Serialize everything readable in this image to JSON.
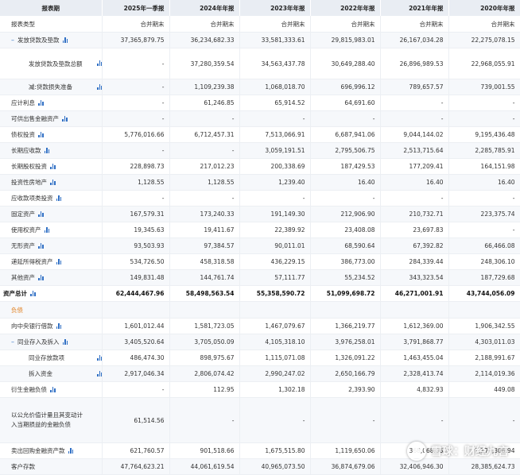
{
  "header": {
    "label": "报表期",
    "periods": [
      "2025年一季报",
      "2024年年报",
      "2023年年报",
      "2022年年报",
      "2021年年报",
      "2020年年报"
    ]
  },
  "report_type": {
    "label": "报表类型",
    "values": [
      "合并期末",
      "合并期末",
      "合并期末",
      "合并期末",
      "合并期末",
      "合并期末"
    ]
  },
  "rows": [
    {
      "label": "发放贷款及垫款",
      "values": [
        "37,365,879.75",
        "36,234,682.33",
        "33,581,333.61",
        "29,815,983.01",
        "26,167,034.28",
        "22,275,078.15"
      ]
    },
    {
      "label": "发放贷款及垫款总额",
      "values": [
        "-",
        "37,280,359.54",
        "34,563,437.78",
        "30,649,288.40",
        "26,896,989.53",
        "22,968,055.91"
      ]
    },
    {
      "label": "减:贷款损失准备",
      "values": [
        "-",
        "1,109,239.38",
        "1,068,018.70",
        "696,996.12",
        "789,657.57",
        "739,001.55"
      ]
    },
    {
      "label": "应计利息",
      "values": [
        "-",
        "61,246.85",
        "65,914.52",
        "64,691.60",
        "-",
        "-"
      ]
    },
    {
      "label": "可供出售金融资产",
      "values": [
        "-",
        "-",
        "-",
        "-",
        "-",
        "-"
      ]
    },
    {
      "label": "债权投资",
      "values": [
        "5,776,016.66",
        "6,712,457.31",
        "7,513,066.91",
        "6,687,941.06",
        "9,044,144.02",
        "9,195,436.48"
      ]
    },
    {
      "label": "长期应收款",
      "values": [
        "-",
        "-",
        "3,059,191.51",
        "2,795,506.75",
        "2,513,715.64",
        "2,285,785.91"
      ]
    },
    {
      "label": "长期股权投资",
      "values": [
        "228,898.73",
        "217,012.23",
        "200,338.69",
        "187,429.53",
        "177,209.41",
        "164,151.98"
      ]
    },
    {
      "label": "投资性房地产",
      "values": [
        "1,128.55",
        "1,128.55",
        "1,239.40",
        "16.40",
        "16.40",
        "16.40"
      ]
    },
    {
      "label": "应收款项类投资",
      "values": [
        "-",
        "-",
        "-",
        "-",
        "-",
        "-"
      ]
    },
    {
      "label": "固定资产",
      "values": [
        "167,579.31",
        "173,240.33",
        "191,149.30",
        "212,906.90",
        "210,732.71",
        "223,375.74"
      ]
    },
    {
      "label": "使用权资产",
      "values": [
        "19,345.63",
        "19,411.67",
        "22,389.92",
        "23,408.08",
        "23,697.83",
        "-"
      ]
    },
    {
      "label": "无形资产",
      "values": [
        "93,503.93",
        "97,384.57",
        "90,011.01",
        "68,590.64",
        "67,392.82",
        "66,466.08"
      ]
    },
    {
      "label": "递延所得税资产",
      "values": [
        "534,726.50",
        "458,318.58",
        "436,229.15",
        "386,773.00",
        "284,339.44",
        "248,306.10"
      ]
    },
    {
      "label": "其他资产",
      "values": [
        "149,831.48",
        "144,761.74",
        "57,111.77",
        "55,234.52",
        "343,323.54",
        "187,729.68"
      ]
    },
    {
      "label": "资产总计",
      "values": [
        "62,444,467.96",
        "58,498,563.54",
        "55,358,590.72",
        "51,099,698.72",
        "46,271,001.91",
        "43,744,056.09"
      ]
    },
    {
      "label": "负债",
      "values": [
        "",
        "",
        "",
        "",
        "",
        ""
      ]
    },
    {
      "label": "向中央银行借款",
      "values": [
        "1,601,012.44",
        "1,581,723.05",
        "1,467,079.67",
        "1,366,219.77",
        "1,612,369.00",
        "1,906,342.55"
      ]
    },
    {
      "label": "同业存入及拆入",
      "values": [
        "3,405,520.64",
        "3,705,050.09",
        "4,105,318.10",
        "3,976,258.01",
        "3,791,868.77",
        "4,303,011.03"
      ]
    },
    {
      "label": "同业存放款项",
      "values": [
        "486,474.30",
        "898,975.67",
        "1,115,071.08",
        "1,326,091.22",
        "1,463,455.04",
        "2,188,991.67"
      ]
    },
    {
      "label": "拆入资金",
      "values": [
        "2,917,046.34",
        "2,806,074.42",
        "2,990,247.02",
        "2,650,166.79",
        "2,328,413.74",
        "2,114,019.36"
      ]
    },
    {
      "label": "衍生金融负债",
      "values": [
        "-",
        "112.95",
        "1,302.18",
        "2,393.90",
        "4,832.93",
        "449.08"
      ]
    },
    {
      "label": "以公允价值计量且其变动计入当期损益的金融负债",
      "values": [
        "61,514.56",
        "-",
        "-",
        "-",
        "-",
        "-"
      ]
    },
    {
      "label": "卖出回购金融资产款",
      "values": [
        "621,760.57",
        "901,518.66",
        "1,675,515.80",
        "1,119,650.06",
        "368,068.05",
        "1,177,306.94"
      ]
    },
    {
      "label": "客户存款",
      "values": [
        "47,764,623.21",
        "44,061,619.54",
        "40,965,073.50",
        "36,874,679.06",
        "32,406,946.30",
        "28,385,624.73"
      ]
    }
  ],
  "watermark": "雪球：财经九言",
  "icons": {
    "collapse": "minus-collapse-icon",
    "chart": "bar-chart-icon"
  },
  "colors": {
    "header_bg": "#e9edf3",
    "link_blue": "#2f6fc4",
    "section_orange": "#e07d1a",
    "alt_row": "#f6f8fb"
  }
}
